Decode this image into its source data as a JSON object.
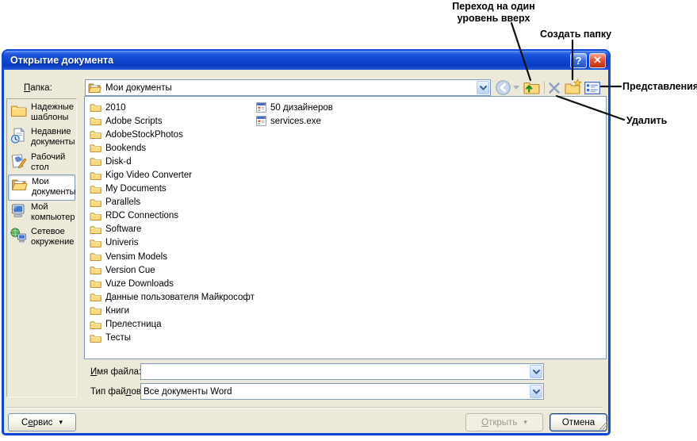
{
  "annotations": {
    "up_level_line1": "Переход на один",
    "up_level_line2": "уровень вверх",
    "create_folder": "Создать папку",
    "views": "Представления",
    "delete": "Удалить"
  },
  "dialog": {
    "title": "Открытие документа",
    "titlebar": {
      "help_glyph": "?",
      "close_glyph": "✕"
    },
    "folder_row": {
      "label_accel": "П",
      "label_rest": "апка:",
      "value": "Мои документы"
    },
    "toolbar_icons": [
      "back-icon",
      "up-one-level-icon",
      "delete-icon",
      "create-folder-icon",
      "views-icon"
    ],
    "sidebar": {
      "items": [
        {
          "icon": "trusted-templates-icon",
          "line1": "Надежные",
          "line2": "шаблоны"
        },
        {
          "icon": "recent-documents-icon",
          "line1": "Недавние",
          "line2": "документы"
        },
        {
          "icon": "desktop-icon",
          "line1": "Рабочий",
          "line2": "стол"
        },
        {
          "icon": "my-documents-icon",
          "line1": "Мои",
          "line2": "документы",
          "selected": true
        },
        {
          "icon": "my-computer-icon",
          "line1": "Мой",
          "line2": "компьютер"
        },
        {
          "icon": "network-icon",
          "line1": "Сетевое",
          "line2": "окружение"
        }
      ]
    },
    "files": {
      "folders": [
        "2010",
        "Adobe Scripts",
        "AdobeStockPhotos",
        "Bookends",
        "Disk-d",
        "Kigo Video Converter",
        "My Documents",
        "Parallels",
        "RDC Connections",
        "Software",
        "Univeris",
        "Vensim Models",
        "Version Cue",
        "Vuze Downloads",
        "Данные пользователя Майкрософт",
        "Книги",
        "Прелестница",
        "Тесты"
      ],
      "programs": [
        "50 дизайнеров",
        "services.exe"
      ]
    },
    "filename_row": {
      "label_accel": "И",
      "label_rest": "мя файла:",
      "value": ""
    },
    "filetype_row": {
      "label_pre": "Тип фай",
      "label_accel": "л",
      "label_rest": "ов:",
      "value": "Все документы Word"
    },
    "buttons": {
      "tools_pre": "С",
      "tools_accel": "е",
      "tools_rest": "рвис",
      "tools_caret": "▾",
      "open_accel": "О",
      "open_rest": "ткрыть",
      "open_caret": "▾",
      "cancel": "Отмена"
    }
  }
}
